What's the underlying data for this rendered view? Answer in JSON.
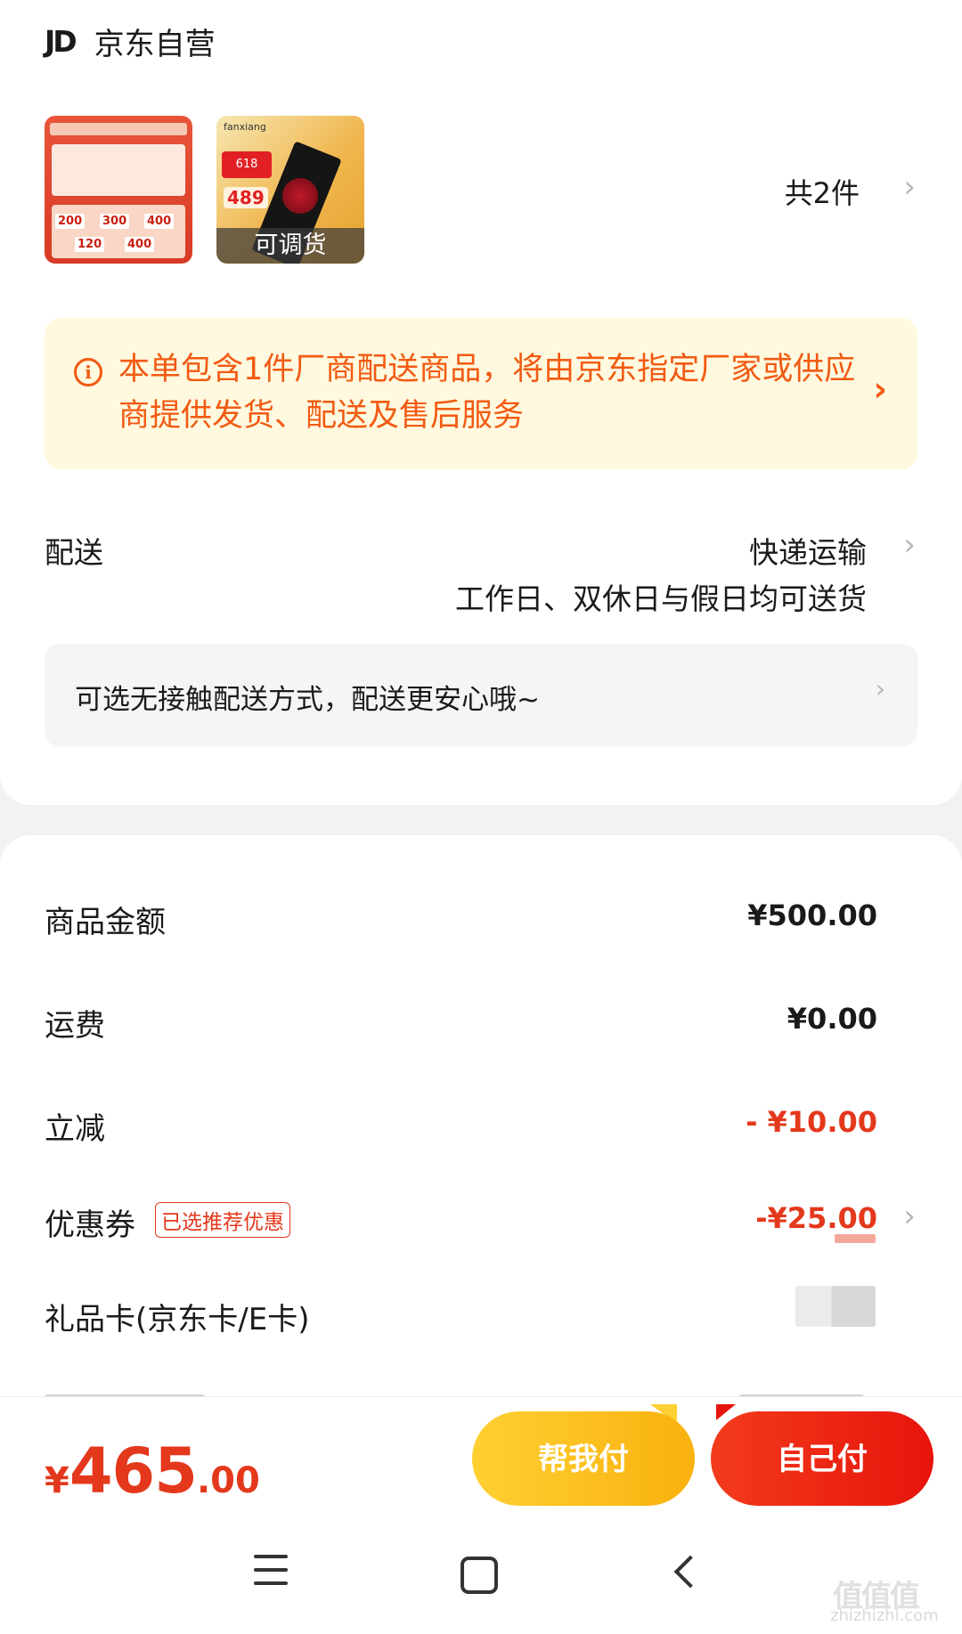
{
  "shop": {
    "logo": "JD",
    "name": "京东自营"
  },
  "products": {
    "count_label": "共2件",
    "thumb1_numbers": [
      "200",
      "300",
      "400",
      "120",
      "400"
    ],
    "thumb2_brand": "fanxiang",
    "thumb2_tag": "618",
    "thumb2_price": "489",
    "thumb2_overlay": "可调货"
  },
  "notice": {
    "icon": "info-icon",
    "text": "本单包含1件厂商配送商品，将由京东指定厂家或供应商提供发货、配送及售后服务",
    "color": "#f25a12"
  },
  "shipping": {
    "label": "配送",
    "method": "快递运输",
    "description": "工作日、双休日与假日均可送货",
    "contactless": "可选无接触配送方式，配送更安心哦~"
  },
  "summary": {
    "goods_label": "商品金额",
    "goods_value": "¥500.00",
    "freight_label": "运费",
    "freight_value": "¥0.00",
    "discount_label": "立减",
    "discount_value": "- ¥10.00",
    "coupon_label": "优惠券",
    "coupon_badge": "已选推荐优惠",
    "coupon_value": "-¥25.00",
    "giftcard_label": "礼品卡(京东卡/E卡)"
  },
  "bottom": {
    "total_symbol": "¥",
    "total_int": "465",
    "total_dec": ".00",
    "help_pay": "帮我付",
    "self_pay": "自己付"
  },
  "watermark": {
    "text": "值值值",
    "url": "zhizhizhi.com"
  },
  "colors": {
    "accent_red": "#e4381c",
    "help_yellow": "#f9b10e",
    "self_red": "#e7140b"
  }
}
